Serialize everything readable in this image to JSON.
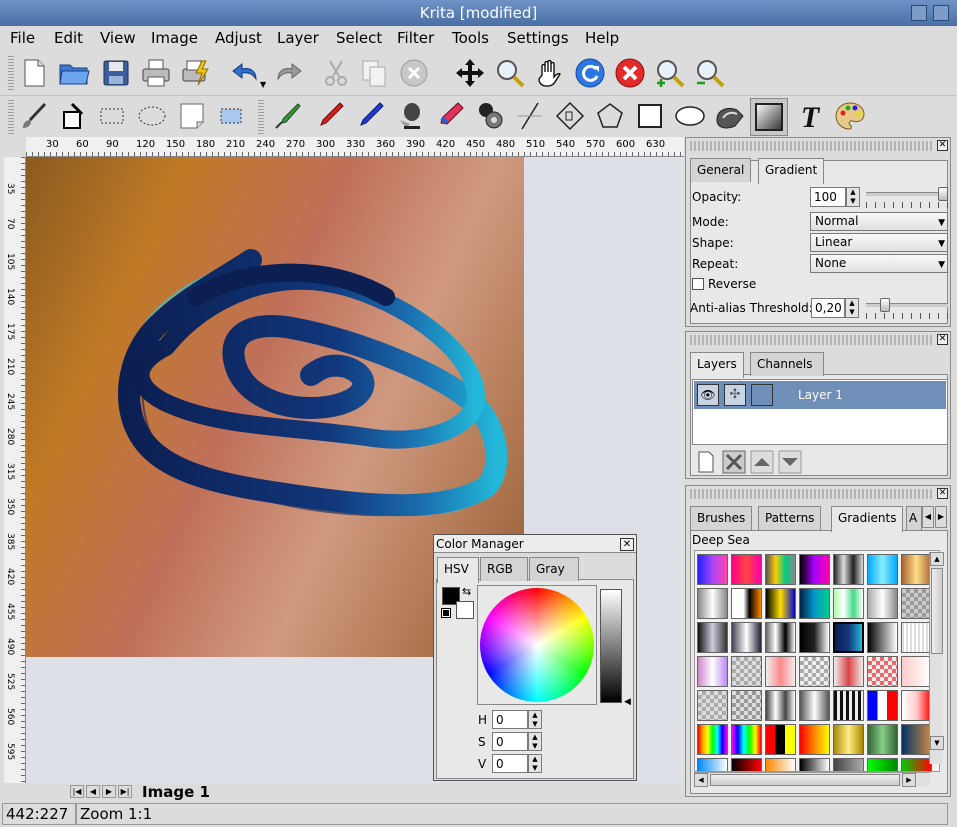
{
  "window": {
    "title": "Krita [modified]"
  },
  "menu": [
    "File",
    "Edit",
    "View",
    "Image",
    "Adjust",
    "Layer",
    "Select",
    "Filter",
    "Tools",
    "Settings",
    "Help"
  ],
  "toolbar1_icons": [
    "new-document-icon",
    "open-folder-icon",
    "save-icon",
    "print-icon",
    "print-preview-icon",
    "undo-icon",
    "redo-icon",
    "cut-icon",
    "copy-icon",
    "paste-icon",
    "move-icon",
    "zoom-icon",
    "pan-hand-icon",
    "refresh-icon",
    "stop-icon",
    "zoom-in-icon",
    "zoom-out-icon"
  ],
  "toolbar2_icons": [
    "brush-icon",
    "fill-icon",
    "rect-select-icon",
    "ellipse-select-icon",
    "transform-icon",
    "selection-icon",
    "color-picker-icon",
    "pen-icon",
    "pen-alt-icon",
    "airbrush-icon",
    "eraser-icon",
    "duplicate-icon",
    "line-icon",
    "polyline-icon",
    "polygon-icon",
    "rectangle-icon",
    "ellipse-icon",
    "smudge-icon",
    "gradient-icon",
    "text-icon",
    "palette-icon"
  ],
  "ruler": {
    "h_ticks": [
      "30",
      "60",
      "90",
      "120",
      "150",
      "180",
      "210",
      "240",
      "270",
      "300",
      "330",
      "360",
      "390",
      "420",
      "450",
      "480",
      "510",
      "540",
      "570",
      "600",
      "630"
    ],
    "v_ticks": [
      "35",
      "70",
      "105",
      "140",
      "175",
      "210",
      "245",
      "280",
      "315",
      "350",
      "385",
      "420",
      "455",
      "490",
      "525",
      "560",
      "595"
    ]
  },
  "gradient_panel": {
    "tabs": [
      "General",
      "Gradient"
    ],
    "opacity_label": "Opacity:",
    "opacity_value": "100",
    "opacity_fraction": 1.0,
    "mode_label": "Mode:",
    "mode_value": "Normal",
    "shape_label": "Shape:",
    "shape_value": "Linear",
    "repeat_label": "Repeat:",
    "repeat_value": "None",
    "reverse_label": "Reverse",
    "antialias_label": "Anti-alias Threshold:",
    "antialias_value": "0,20",
    "antialias_fraction": 0.2
  },
  "layers_panel": {
    "tabs": [
      "Layers",
      "Channels"
    ],
    "layer_name": "Layer 1"
  },
  "resources_panel": {
    "tabs": [
      "Brushes",
      "Patterns",
      "Gradients",
      "A"
    ],
    "selected_gradient_name": "Deep Sea"
  },
  "color_manager": {
    "title": "Color Manager",
    "tabs": [
      "HSV",
      "RGB",
      "Gray"
    ],
    "h_label": "H",
    "h_value": "0",
    "s_label": "S",
    "s_value": "0",
    "v_label": "V",
    "v_value": "0"
  },
  "canvas_tab": {
    "label": "Image 1"
  },
  "status": {
    "coords": "442:227",
    "zoom": "Zoom 1:1"
  },
  "colors": {
    "titlebar": "#4a6fa5",
    "accent_selection": "#6f8fb8",
    "fg_color": "#000000",
    "bg_color": "#ffffff",
    "stroke_dark": "#0b1f52",
    "stroke_light": "#23b8d8"
  }
}
